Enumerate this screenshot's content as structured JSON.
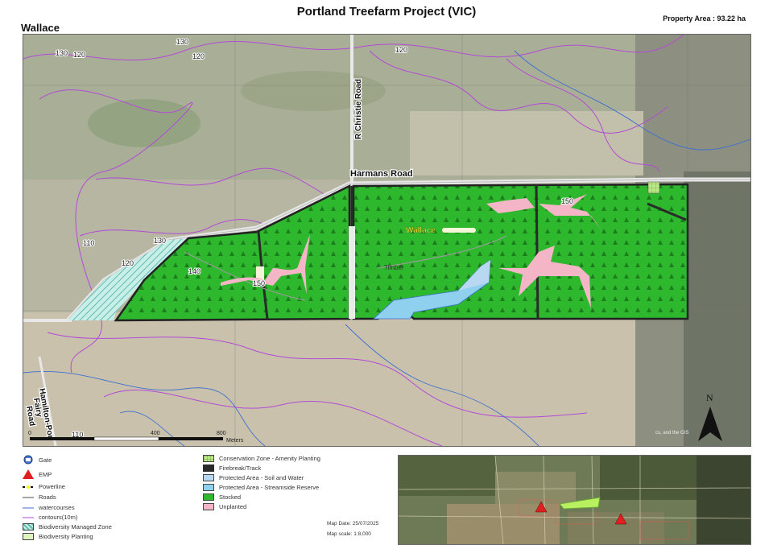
{
  "header": {
    "title": "Portland Treefarm Project (VIC)",
    "property_area": "Property Area : 93.22 ha",
    "property_name": "Wallace"
  },
  "map": {
    "roads": {
      "harmans": "Harmans Road",
      "christie": "R Christie Road",
      "hamilton_line1": "Hamilton-Por",
      "hamilton_line2": "Fairy",
      "hamilton_line3": "Road"
    },
    "labels": {
      "wallace": "Wallace",
      "timber": "Timber"
    },
    "contours": [
      "130",
      "120",
      "130",
      "120",
      "120",
      "110",
      "130",
      "120",
      "140",
      "150",
      "150",
      "110"
    ],
    "scale": {
      "zero": "0",
      "mid": "400",
      "end": "800",
      "units": "Meters"
    },
    "north": "N",
    "attribution": "cs, and the GIS"
  },
  "legend": {
    "col1": [
      {
        "label": "Gate",
        "icon": "gate-icon"
      },
      {
        "label": "EMP",
        "icon": "emp-triangle-icon"
      },
      {
        "label": "Powerline",
        "icon": "powerline-icon"
      },
      {
        "label": "Roads",
        "icon": "road-line-icon"
      },
      {
        "label": "watercourses",
        "icon": "watercourse-line-icon"
      },
      {
        "label": "contours(10m)",
        "icon": "contour-line-icon"
      },
      {
        "label": "Biodiversity Managed Zone",
        "icon": "hatched-swatch"
      },
      {
        "label": "Biodiversity Planting",
        "icon": "light-green-swatch"
      }
    ],
    "col2": [
      {
        "label": "Conservation Zone - Amenity Planting"
      },
      {
        "label": "Firebreak/Track"
      },
      {
        "label": "Protected Area - Soil and Water"
      },
      {
        "label": "Protected Area - Streamside Reserve"
      },
      {
        "label": "Stocked"
      },
      {
        "label": "Unplanted"
      }
    ],
    "map_date": "Map Date: 25/07/2025",
    "map_scale": "Map scale: 1:8,000"
  },
  "colors": {
    "stocked": "#2db82d",
    "unplanted": "#f4b6c6",
    "firebreak": "#2a2a2a",
    "soil_water": "#b8d8f2",
    "streamside": "#8fd0ee",
    "conservation": "#bde88a",
    "contour": "#b24bd6",
    "watercourse": "#3f6fd0",
    "emp": "#e02020"
  }
}
